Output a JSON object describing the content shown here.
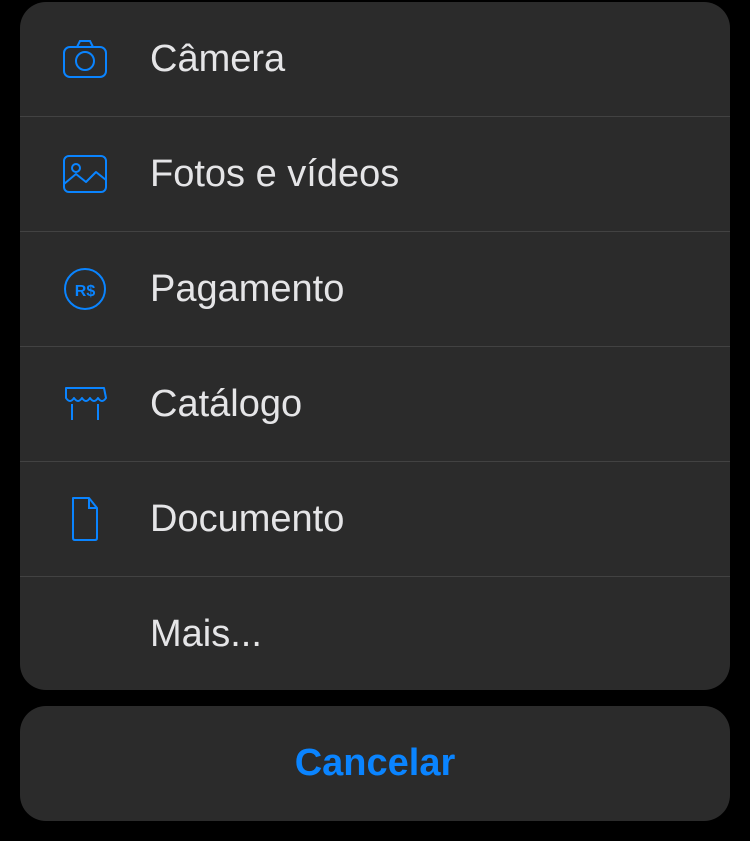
{
  "actions": {
    "camera": {
      "label": "Câmera"
    },
    "photos": {
      "label": "Fotos e vídeos"
    },
    "payment": {
      "label": "Pagamento"
    },
    "catalog": {
      "label": "Catálogo"
    },
    "document": {
      "label": "Documento"
    },
    "more": {
      "label": "Mais..."
    }
  },
  "cancel": {
    "label": "Cancelar"
  },
  "colors": {
    "accent": "#0a84ff",
    "text": "#e5e5e7",
    "sheet_bg": "rgba(50,50,50,0.85)"
  }
}
